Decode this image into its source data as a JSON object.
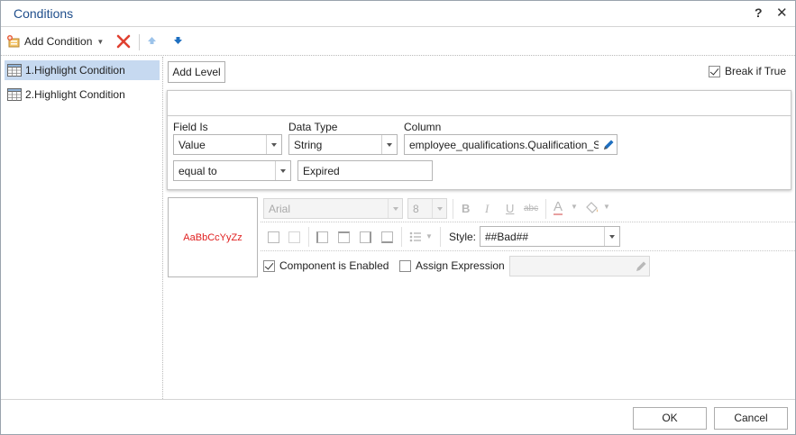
{
  "dialog": {
    "title": "Conditions"
  },
  "toolbar": {
    "add_condition_label": "Add Condition"
  },
  "conditions": [
    {
      "label": "1.Highlight Condition",
      "selected": true
    },
    {
      "label": "2.Highlight Condition",
      "selected": false
    }
  ],
  "level": {
    "add_level_label": "Add Level",
    "break_if_true_label": "Break if True",
    "break_if_true_checked": true
  },
  "condition": {
    "field_is_label": "Field Is",
    "field_is_value": "Value",
    "data_type_label": "Data Type",
    "data_type_value": "String",
    "column_label": "Column",
    "column_value": "employee_qualifications.Qualification_S",
    "operator_value": "equal to",
    "compare_value": "Expired"
  },
  "format": {
    "preview_text": "AaBbCcYyZz",
    "preview_color": "#e02020",
    "font_family_value": "Arial",
    "font_size_value": "8",
    "style_label": "Style:",
    "style_value": "##Bad##",
    "component_enabled_label": "Component is Enabled",
    "component_enabled_checked": true,
    "assign_expression_label": "Assign Expression",
    "assign_expression_checked": false
  },
  "footer": {
    "ok_label": "OK",
    "cancel_label": "Cancel"
  },
  "colors": {
    "title": "#1f4e8c",
    "selection": "#c6d9f0",
    "delete": "#e04030",
    "arrow": "#1e6fc0"
  }
}
